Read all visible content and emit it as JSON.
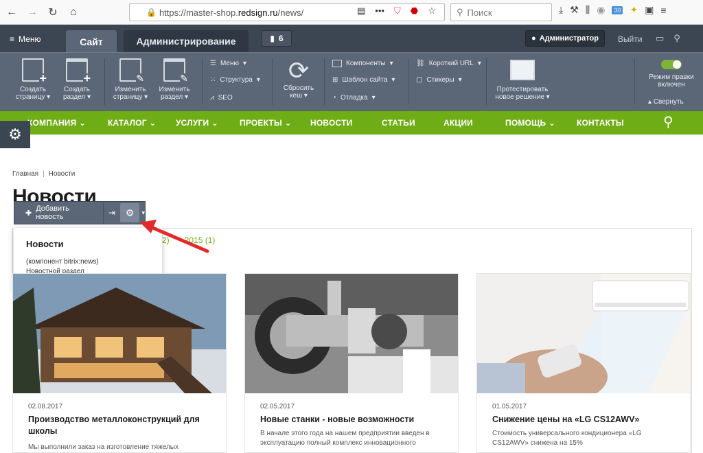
{
  "browser": {
    "url_prefix": "https://master-shop.",
    "url_host": "redsign.ru",
    "url_path": "/news/",
    "search_placeholder": "Поиск",
    "badge_count": "30",
    "more_label": "•••"
  },
  "admin_panel": {
    "menu_label": "Меню",
    "tab_site": "Сайт",
    "tab_admin": "Администрирование",
    "notifications_count": "6",
    "user_label": "Администратор",
    "logout_label": "Выйти",
    "actions": {
      "create_page": "Создать страницу",
      "create_section": "Создать раздел",
      "edit_page": "Изменить страницу",
      "edit_section": "Изменить раздел",
      "menu": "Меню",
      "structure": "Структура",
      "seo": "SEO",
      "reset_cache": "Сбросить кеш",
      "components": "Компоненты",
      "site_template": "Шаблон сайта",
      "debug": "Отладка",
      "short_url": "Короткий URL",
      "stickers": "Стикеры",
      "test_solution": "Протестировать новое решение",
      "edit_mode": "Режим правки включен",
      "collapse": "Свернуть"
    }
  },
  "site_nav": {
    "items": [
      "КОМПАНИЯ",
      "КАТАЛОГ",
      "УСЛУГИ",
      "ПРОЕКТЫ",
      "НОВОСТИ",
      "СТАТЬИ",
      "АКЦИИ",
      "ПОМОЩЬ",
      "КОНТАКТЫ"
    ]
  },
  "page": {
    "breadcrumb": [
      "Главная",
      "Новости"
    ],
    "title": "Новости",
    "year_2016": "2)",
    "year_2015": "2015 (1)"
  },
  "edit_toolbar": {
    "add_news": "Добавить новость"
  },
  "popup": {
    "title": "Новости",
    "component": "(компонент bitrix:news)",
    "description": "Новостной раздел"
  },
  "news": [
    {
      "date": "02.08.2017",
      "title": "Производство металлоконструкций для школы",
      "desc": "Мы выполнили заказ на изготовление тяжелых"
    },
    {
      "date": "02.05.2017",
      "title": "Новые станки - новые возможности",
      "desc": "В начале этого года на нашем предприятии введен в эксплуатацию полный комплекс инновационного"
    },
    {
      "date": "01.05.2017",
      "title": "Снижение цены на «LG CS12AWV»",
      "desc": "Стоимость универсального кондиционера «LG CS12AWV» снижена на 15%"
    }
  ]
}
